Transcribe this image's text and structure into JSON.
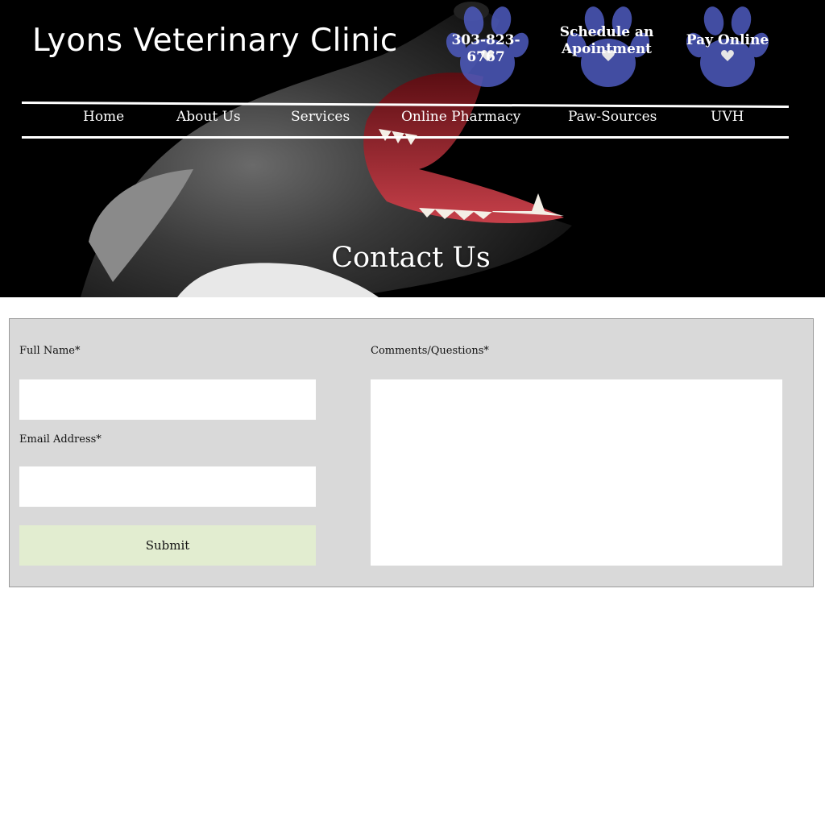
{
  "header": {
    "site_title": "Lyons Veterinary Clinic",
    "phone": "303-823-6767",
    "schedule_label": "Schedule an Apointment",
    "pay_label": "Pay Online",
    "paw_color": "#4e5bbf"
  },
  "nav": {
    "items": [
      {
        "label": "Home"
      },
      {
        "label": "About Us"
      },
      {
        "label": "Services"
      },
      {
        "label": "Online Pharmacy"
      },
      {
        "label": "Paw-Sources"
      },
      {
        "label": "UVH"
      }
    ]
  },
  "page": {
    "heading": "Contact Us"
  },
  "form": {
    "full_name_label": "Full Name*",
    "full_name_value": "",
    "email_label": "Email Address*",
    "email_value": "",
    "comments_label": "Comments/Questions*",
    "comments_value": "",
    "submit_label": "Submit",
    "submit_color": "#e2edd0",
    "panel_color": "#d9d9d9"
  }
}
